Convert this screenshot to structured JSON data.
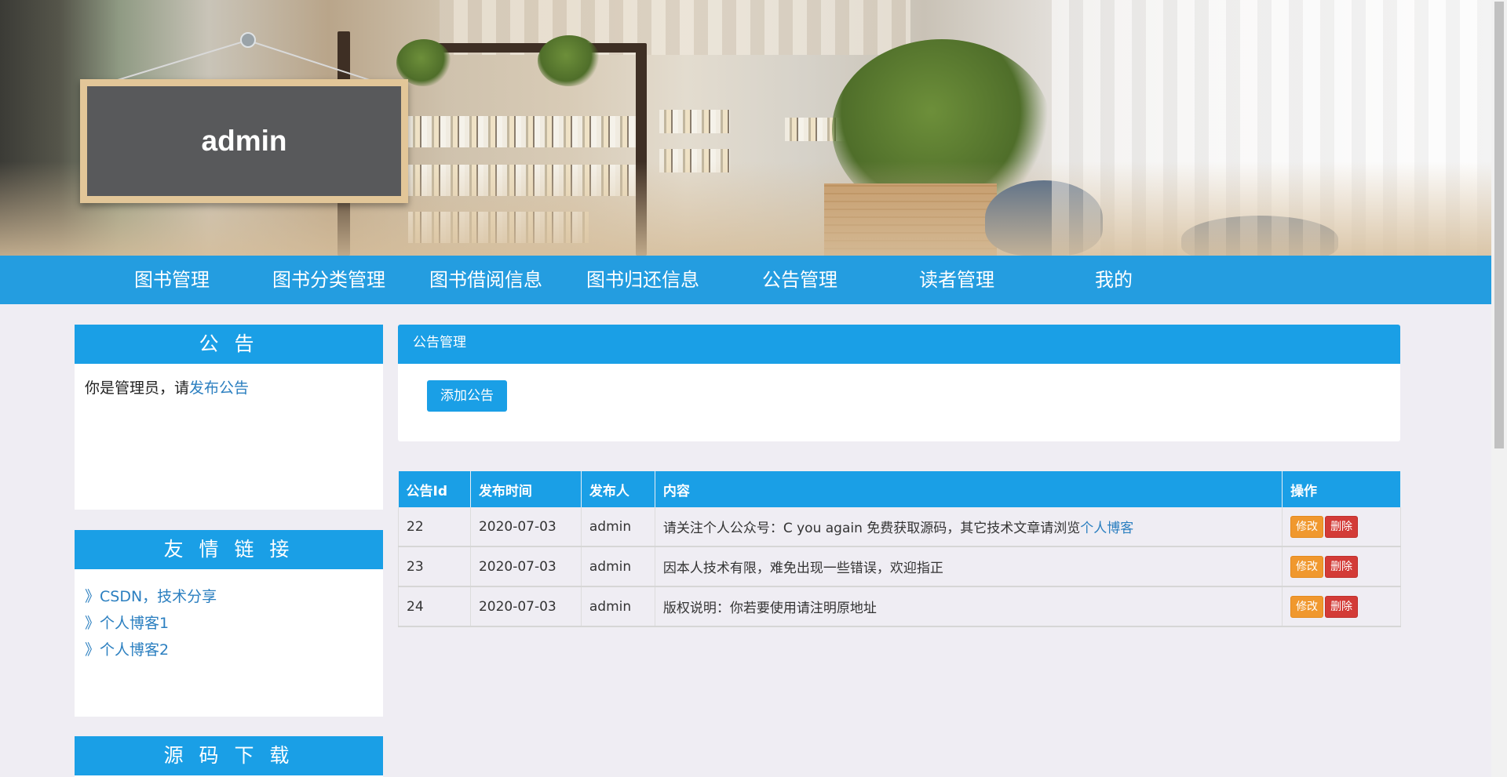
{
  "banner": {
    "title": "admin"
  },
  "nav": {
    "items": [
      "图书管理",
      "图书分类管理",
      "图书借阅信息",
      "图书归还信息",
      "公告管理",
      "读者管理",
      "我的"
    ]
  },
  "notice": {
    "title": "公 告",
    "text": "你是管理员，请",
    "link": "发布公告"
  },
  "friend_links": {
    "title": "友 情 链 接",
    "items": [
      "》CSDN，技术分享",
      "》个人博客1",
      "》个人博客2"
    ]
  },
  "source": {
    "title": "源 码 下 载"
  },
  "manage": {
    "title": "公告管理",
    "add_button": "添加公告"
  },
  "table": {
    "headers": [
      "公告Id",
      "发布时间",
      "发布人",
      "内容",
      "操作"
    ],
    "rows": [
      {
        "id": "22",
        "date": "2020-07-03",
        "author": "admin",
        "content": "请关注个人公众号：C you again 免费获取源码，其它技术文章请浏览",
        "content_link": "个人博客"
      },
      {
        "id": "23",
        "date": "2020-07-03",
        "author": "admin",
        "content": "因本人技术有限，难免出现一些错误，欢迎指正",
        "content_link": ""
      },
      {
        "id": "24",
        "date": "2020-07-03",
        "author": "admin",
        "content": "版权说明：你若要使用请注明原地址",
        "content_link": ""
      }
    ],
    "edit_label": "修改",
    "delete_label": "删除"
  }
}
